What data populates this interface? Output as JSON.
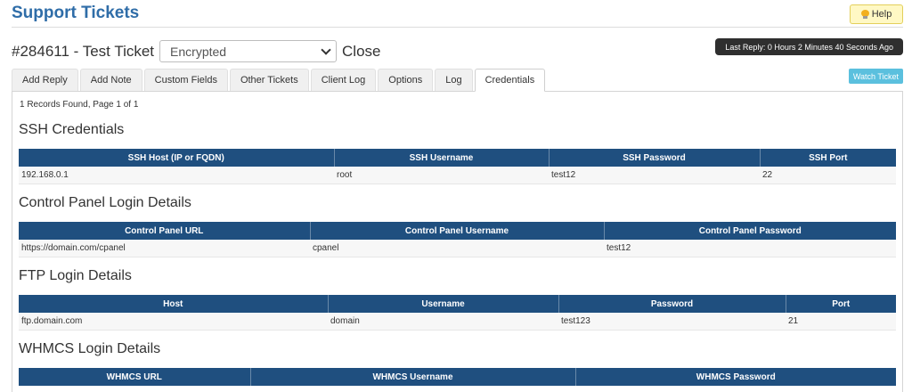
{
  "header": {
    "title": "Support Tickets",
    "help_label": "Help"
  },
  "ticket": {
    "id_title": "#284611 - Test Ticket",
    "status_value": "Encrypted",
    "close_label": "Close",
    "last_reply": "Last Reply: 0 Hours 2 Minutes 40 Seconds Ago",
    "watch_label": "Watch Ticket"
  },
  "tabs": [
    {
      "label": "Add Reply"
    },
    {
      "label": "Add Note"
    },
    {
      "label": "Custom Fields"
    },
    {
      "label": "Other Tickets"
    },
    {
      "label": "Client Log"
    },
    {
      "label": "Options"
    },
    {
      "label": "Log"
    },
    {
      "label": "Credentials",
      "active": true
    }
  ],
  "records_text": "1 Records Found, Page 1 of 1",
  "sections": {
    "ssh": {
      "title": "SSH Credentials",
      "columns": [
        "SSH Host (IP or FQDN)",
        "SSH Username",
        "SSH Password",
        "SSH Port"
      ],
      "row": [
        "192.168.0.1",
        "root",
        "test12",
        "22"
      ]
    },
    "cpanel": {
      "title": "Control Panel Login Details",
      "columns": [
        "Control Panel URL",
        "Control Panel Username",
        "Control Panel Password"
      ],
      "row": [
        "https://domain.com/cpanel",
        "cpanel",
        "test12"
      ]
    },
    "ftp": {
      "title": "FTP Login Details",
      "columns": [
        "Host",
        "Username",
        "Password",
        "Port"
      ],
      "row": [
        "ftp.domain.com",
        "domain",
        "test123",
        "21"
      ]
    },
    "whmcs": {
      "title": "WHMCS Login Details",
      "columns": [
        "WHMCS URL",
        "WHMCS Username",
        "WHMCS Password"
      ]
    }
  }
}
